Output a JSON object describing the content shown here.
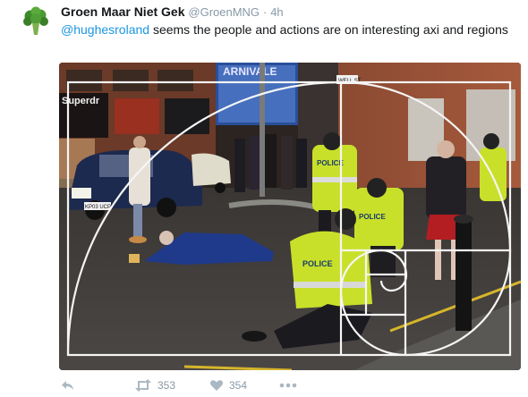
{
  "tweet": {
    "author_name": "Groen Maar Niet Gek",
    "author_handle": "@GroenMNG",
    "separator": "·",
    "time": "4h",
    "mention": "@hughesroland",
    "text_rest": " seems the people and actions are on interesting axi and regions",
    "avatar_icon": "broccoli-icon"
  },
  "photo": {
    "alt_icon": "street-scene-golden-spiral-photo",
    "signs": {
      "shop_left": "Superdr",
      "shop_center": "ARNIVALE",
      "police_back": "POLICE",
      "police_front": "POLICE",
      "police_third": "POLICE",
      "car_plate": "KP03 UCP",
      "street_sign": "WELL ST"
    },
    "spiral_color": "#f5f5f5"
  },
  "actions": {
    "reply_icon": "reply-icon",
    "retweet_icon": "retweet-icon",
    "retweet_count": "353",
    "like_icon": "heart-icon",
    "like_count": "354",
    "more_icon": "more-icon"
  }
}
